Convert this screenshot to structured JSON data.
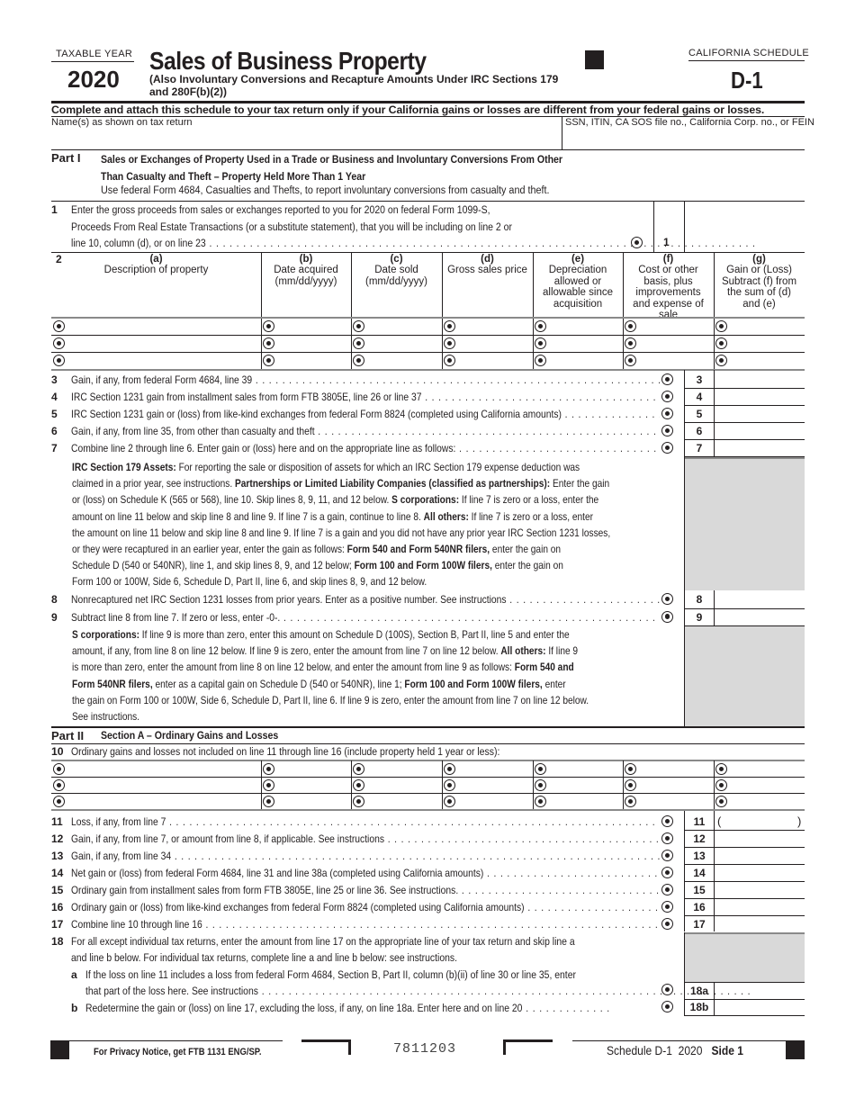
{
  "header": {
    "taxable_year_label": "TAXABLE YEAR",
    "year": "2020",
    "title": "Sales of Business Property",
    "subtitle_line1": "(Also Involuntary Conversions and Recapture Amounts Under IRC Sections 179",
    "subtitle_line2": "and 280F(b)(2))",
    "schedule_label": "CALIFORNIA SCHEDULE",
    "schedule_id": "D-1",
    "instruction": "Complete and attach this schedule to your tax return only if your California gains or losses are different from your federal gains or losses.",
    "name_label": "Name(s) as shown on tax return",
    "id_label": "SSN, ITIN, CA SOS file no., California Corp. no., or FEIN",
    "name_value": "",
    "id_value": ""
  },
  "part1": {
    "label": "Part I",
    "title_line1": "Sales or Exchanges of Property Used in a Trade or Business and Involuntary Conversions From Other",
    "title_line2": "Than Casualty and Theft – Property Held More Than 1 Year",
    "note": "Use federal Form 4684, Casualties and Thefts, to report involuntary conversions from casualty and theft.",
    "line1": {
      "num": "1",
      "text_l1": "Enter the gross proceeds from sales or exchanges reported to you for 2020 on federal Form 1099-S,",
      "text_l2": "Proceeds From Real Estate Transactions (or a substitute statement), that you will be including on line 2 or",
      "text_l3": "line 10, column (d), or on line 23",
      "box": "1",
      "value": ""
    },
    "line2_num": "2",
    "columns": [
      {
        "letter": "(a)",
        "label": "Description of property"
      },
      {
        "letter": "(b)",
        "label": "Date acquired (mm/dd/yyyy)"
      },
      {
        "letter": "(c)",
        "label": "Date sold (mm/dd/yyyy)"
      },
      {
        "letter": "(d)",
        "label": "Gross sales price"
      },
      {
        "letter": "(e)",
        "label": "Depreciation allowed or allowable since acquisition"
      },
      {
        "letter": "(f)",
        "label": "Cost or other basis, plus improvements and expense of sale"
      },
      {
        "letter": "(g)",
        "label": "Gain or (Loss) Subtract (f) from the sum of (d) and (e)"
      }
    ],
    "lines": [
      {
        "num": "3",
        "text": "Gain, if any, from federal Form 4684, line 39",
        "box": "3",
        "value": ""
      },
      {
        "num": "4",
        "text": "IRC Section 1231 gain from installment sales from form FTB 3805E, line 26 or line 37",
        "box": "4",
        "value": ""
      },
      {
        "num": "5",
        "text": "IRC Section 1231 gain or (loss) from like-kind exchanges from federal Form 8824 (completed using California amounts)",
        "box": "5",
        "value": ""
      },
      {
        "num": "6",
        "text": "Gain, if any, from line 35, from other than casualty and theft",
        "box": "6",
        "value": ""
      },
      {
        "num": "7",
        "text": "Combine line 2 through line 6. Enter gain or (loss) here and on the appropriate line as follows:",
        "box": "7",
        "value": ""
      }
    ],
    "line7_instructions": [
      [
        {
          "b": "IRC Section 179 Assets:"
        },
        {
          "t": " For reporting the sale or disposition of assets for which an IRC Section 179 expense deduction was"
        }
      ],
      [
        {
          "t": "claimed in a prior year, see instructions. "
        },
        {
          "b": "Partnerships or Limited Liability Companies (classified as partnerships):"
        },
        {
          "t": " Enter the gain"
        }
      ],
      [
        {
          "t": "or (loss) on Schedule K (565 or 568), line 10. Skip lines 8, 9, 11, and 12 below. "
        },
        {
          "b": "S corporations:"
        },
        {
          "t": " If line 7 is zero or a loss, enter the"
        }
      ],
      [
        {
          "t": "amount on line 11 below and skip line 8 and line 9. If line 7 is a gain, continue to line 8. "
        },
        {
          "b": "All others:"
        },
        {
          "t": " If line 7 is zero or a loss, enter"
        }
      ],
      [
        {
          "t": "the amount on line 11 below and skip line 8 and line 9. If line 7 is a gain and you did not have any prior year IRC Section 1231 losses,"
        }
      ],
      [
        {
          "t": "or they were recaptured in an earlier year, enter the gain as follows: "
        },
        {
          "b": "Form 540 and Form 540NR filers,"
        },
        {
          "t": " enter the gain on"
        }
      ],
      [
        {
          "t": "Schedule D (540 or 540NR), line 1, and skip lines 8, 9, and 12 below; "
        },
        {
          "b": "Form 100 and Form 100W filers,"
        },
        {
          "t": " enter the gain on"
        }
      ],
      [
        {
          "t": "Form 100 or 100W, Side 6, Schedule D, Part II, line 6, and skip lines 8, 9, and 12 below."
        }
      ]
    ],
    "lines_8_9": [
      {
        "num": "8",
        "text": "Nonrecaptured net IRC Section 1231 losses from prior years. Enter as a positive number. See instructions",
        "box": "8",
        "value": ""
      },
      {
        "num": "9",
        "text": "Subtract line 8 from line 7. If zero or less, enter -0-.",
        "box": "9",
        "value": ""
      }
    ],
    "line9_instructions": [
      [
        {
          "b": "S corporations:"
        },
        {
          "t": " If line 9 is more than zero, enter this amount on Schedule D (100S), Section B, Part II, line 5 and enter the"
        }
      ],
      [
        {
          "t": "amount, if any, from line 8 on line 12 below. If line 9 is zero, enter the amount from line 7 on line 12 below. "
        },
        {
          "b": "All others:"
        },
        {
          "t": " If line 9"
        }
      ],
      [
        {
          "t": "is more than zero, enter the amount from line 8 on line 12 below, and enter the amount from line 9 as follows: "
        },
        {
          "b": "Form 540 and"
        }
      ],
      [
        {
          "b": "Form 540NR filers,"
        },
        {
          "t": " enter as a capital gain on Schedule D (540 or 540NR), line 1; "
        },
        {
          "b": "Form 100 and Form 100W filers,"
        },
        {
          "t": " enter"
        }
      ],
      [
        {
          "t": "the gain on Form 100 or 100W, Side 6, Schedule D, Part II, line 6. If line 9 is zero, enter the amount from line 7 on line 12 below."
        }
      ],
      [
        {
          "t": "See instructions."
        }
      ]
    ]
  },
  "part2": {
    "label": "Part II",
    "title": "Section A – Ordinary Gains and Losses",
    "line10": {
      "num": "10",
      "text": "Ordinary gains and losses not included on line 11 through line 16 (include property held 1 year or less):"
    },
    "lines": [
      {
        "num": "11",
        "text": "Loss, if any, from line 7",
        "box": "11",
        "value": "",
        "open_paren": "(",
        "close_paren": ")"
      },
      {
        "num": "12",
        "text": "Gain, if any, from line 7, or amount from line 8, if applicable. See instructions",
        "box": "12",
        "value": ""
      },
      {
        "num": "13",
        "text": "Gain, if any, from line 34",
        "box": "13",
        "value": ""
      },
      {
        "num": "14",
        "text": "Net gain or (loss) from federal Form 4684, line 31 and line 38a (completed using California amounts)",
        "box": "14",
        "value": ""
      },
      {
        "num": "15",
        "text": "Ordinary gain from installment sales from form FTB 3805E, line 25 or line 36. See instructions.",
        "box": "15",
        "value": ""
      },
      {
        "num": "16",
        "text": "Ordinary gain or (loss) from like-kind exchanges from federal Form 8824 (completed using California amounts)",
        "box": "16",
        "value": ""
      },
      {
        "num": "17",
        "text": "Combine line 10 through line 16",
        "box": "17",
        "value": ""
      }
    ],
    "line18": {
      "num": "18",
      "text_l1": "For all except individual tax returns, enter the amount from line 17 on the appropriate line of your tax return and skip line a",
      "text_l2": "and line b below. For individual tax returns, complete line a and line b below: see instructions.",
      "a_letter": "a",
      "a_text_l1": "If the loss on line 11 includes a loss from federal Form 4684, Section B, Part II, column (b)(ii) of line 30 or line 35, enter",
      "a_text_l2": "that part of the loss here. See instructions",
      "a_box": "18a",
      "a_value": "",
      "b_letter": "b",
      "b_text": "Redetermine the gain or (loss) on line 17, excluding the loss, if any, on line 18a. Enter here and on line 20",
      "b_box": "18b",
      "b_value": ""
    }
  },
  "footer": {
    "privacy": "For Privacy Notice, get FTB 1131 ENG/SP.",
    "form_code": "7811203",
    "schedule": "Schedule D-1  2020",
    "side": "Side 1"
  }
}
